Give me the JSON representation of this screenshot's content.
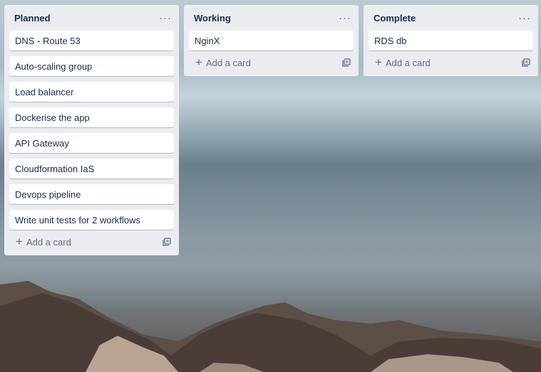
{
  "lists": [
    {
      "title": "Planned",
      "menu_icon": "ellipsis-icon",
      "cards": [
        "DNS - Route 53",
        "Auto-scaling group",
        "Load balancer",
        "Dockerise the app",
        "API Gateway",
        "Cloudformation IaS",
        "Devops pipeline",
        "Write unit tests for 2 workflows"
      ],
      "add_label": "Add a card"
    },
    {
      "title": "Working",
      "menu_icon": "ellipsis-icon",
      "cards": [
        "NginX"
      ],
      "add_label": "Add a card"
    },
    {
      "title": "Complete",
      "menu_icon": "ellipsis-icon",
      "cards": [
        "RDS db"
      ],
      "add_label": "Add a card"
    }
  ],
  "colors": {
    "list_bg": "#ebecf0",
    "card_bg": "#ffffff",
    "text": "#172b4d",
    "muted": "#5e6c84"
  }
}
